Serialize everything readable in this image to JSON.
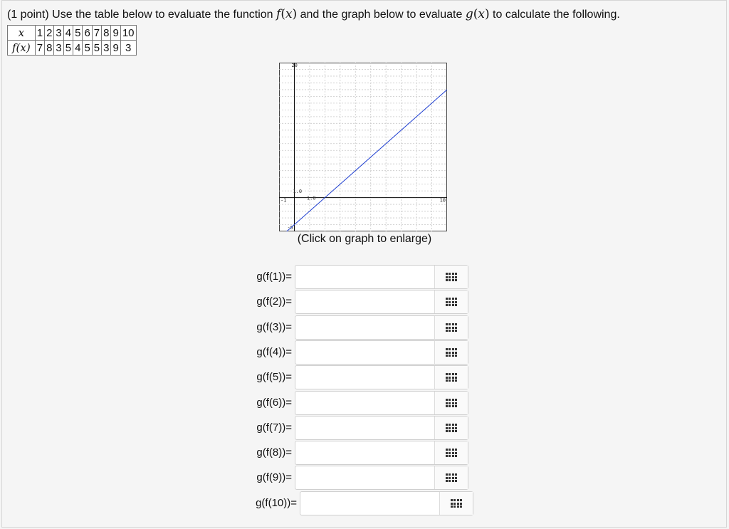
{
  "problem": {
    "intro": "(1 point) Use the table below to evaluate the function ",
    "f_name": "f",
    "mid": " and the graph below to evaluate ",
    "g_name": "g",
    "x_var": "x",
    "outro": " to calculate the following."
  },
  "table": {
    "x_label": "x",
    "fx_label": "f(x)",
    "x_values": [
      "1",
      "2",
      "3",
      "4",
      "5",
      "6",
      "7",
      "8",
      "9",
      "10"
    ],
    "fx_values": [
      "7",
      "8",
      "3",
      "5",
      "4",
      "5",
      "5",
      "3",
      "9",
      "3"
    ]
  },
  "graph": {
    "caption": "(Click on graph to enlarge)",
    "line_color": "#1f3fd0",
    "tick_labels": {
      "ymax": "20",
      "ymin": "-5",
      "xmin": "-1",
      "xmax": "10",
      "ystep": "1.0",
      "xstep": "1.0"
    }
  },
  "chart_data": {
    "type": "line",
    "xlim": [
      -1,
      10
    ],
    "ylim": [
      -5,
      20
    ],
    "grid": true,
    "series": [
      {
        "x": [
          -1,
          10
        ],
        "y": [
          -6,
          16
        ]
      }
    ]
  },
  "answers": [
    {
      "label": "g(f(1))=",
      "value": ""
    },
    {
      "label": "g(f(2))=",
      "value": ""
    },
    {
      "label": "g(f(3))=",
      "value": ""
    },
    {
      "label": "g(f(4))=",
      "value": ""
    },
    {
      "label": "g(f(5))=",
      "value": ""
    },
    {
      "label": "g(f(6))=",
      "value": ""
    },
    {
      "label": "g(f(7))=",
      "value": ""
    },
    {
      "label": "g(f(8))=",
      "value": ""
    },
    {
      "label": "g(f(9))=",
      "value": ""
    },
    {
      "label": "g(f(10))=",
      "value": ""
    }
  ],
  "icons": {
    "equation_editor": "grid-icon"
  }
}
